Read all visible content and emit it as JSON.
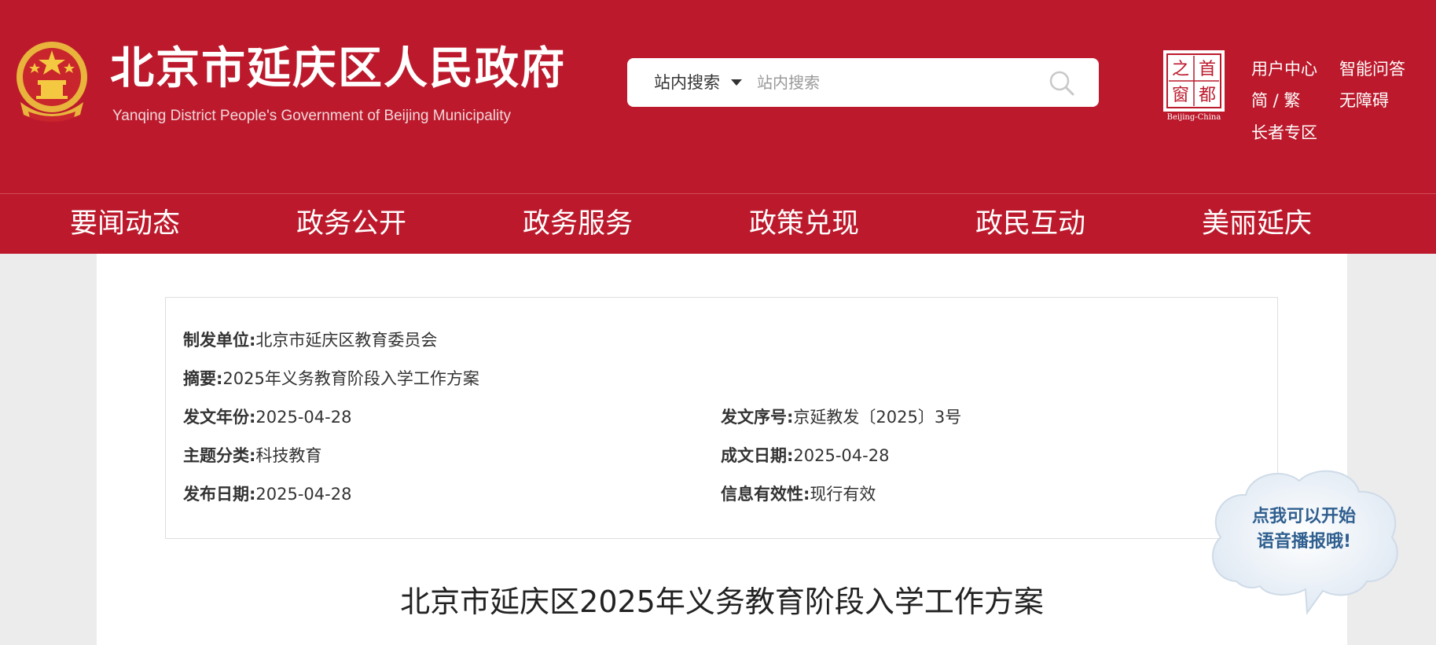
{
  "header": {
    "title": "北京市延庆区人民政府",
    "subtitle": "Yanqing District People's Government of Beijing Municipality",
    "brand_color": "#bc1a2c",
    "emblem_icon": "national-emblem-icon"
  },
  "search": {
    "scope_label": "站内搜索",
    "placeholder": "站内搜索",
    "icon": "search-icon"
  },
  "capital_logo": {
    "chars": [
      "首",
      "都",
      "之",
      "窗"
    ],
    "caption": "Beijing-China"
  },
  "top_links": {
    "user_center": "用户中心",
    "smart_qa": "智能问答",
    "language": "简 / 繁",
    "accessibility": "无障碍",
    "elderly": "长者专区"
  },
  "nav": {
    "items": [
      "要闻动态",
      "政务公开",
      "政务服务",
      "政策兑现",
      "政民互动",
      "美丽延庆"
    ]
  },
  "meta": {
    "issuer_label": "制发单位:",
    "issuer": "北京市延庆区教育委员会",
    "summary_label": "摘要:",
    "summary": "2025年义务教育阶段入学工作方案",
    "year_label": "发文年份:",
    "year": "2025-04-28",
    "doc_no_label": "发文序号:",
    "doc_no": "京延教发〔2025〕3号",
    "topic_label": "主题分类:",
    "topic": "科技教育",
    "written_date_label": "成文日期:",
    "written_date": "2025-04-28",
    "publish_date_label": "发布日期:",
    "publish_date": "2025-04-28",
    "validity_label": "信息有效性:",
    "validity": "现行有效"
  },
  "document": {
    "title": "北京市延庆区2025年义务教育阶段入学工作方案"
  },
  "voice_bubble": {
    "line1": "点我可以开始",
    "line2": "语音播报哦!"
  }
}
